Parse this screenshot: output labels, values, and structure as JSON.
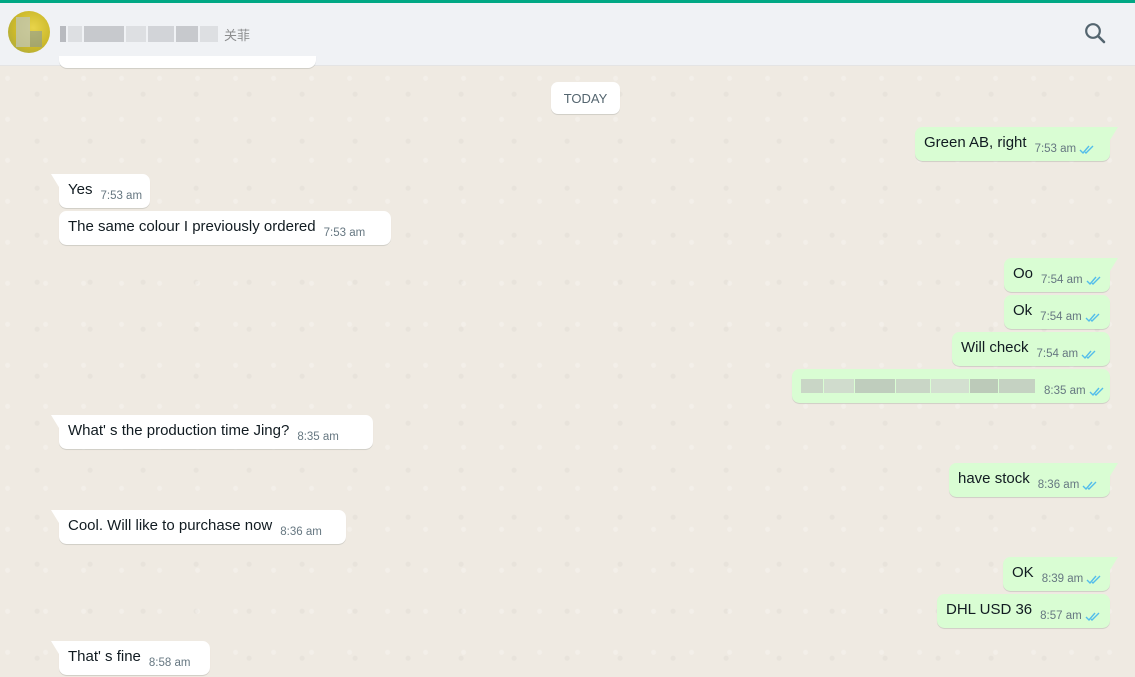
{
  "header": {
    "contact_name_visible": "关菲",
    "search_icon": "search-icon",
    "accent_color": "#00a884"
  },
  "chat": {
    "day_label": "TODAY",
    "messages": [
      {
        "dir": "out",
        "text": "Green AB, right",
        "time": "7:53 am",
        "status": "read"
      },
      {
        "dir": "in",
        "text": "Yes",
        "time": "7:53 am"
      },
      {
        "dir": "in",
        "text": "The same colour I previously ordered",
        "time": "7:53 am"
      },
      {
        "dir": "out",
        "text": "Oo",
        "time": "7:54 am",
        "status": "read"
      },
      {
        "dir": "out",
        "text": "Ok",
        "time": "7:54 am",
        "status": "read"
      },
      {
        "dir": "out",
        "text": "Will check",
        "time": "7:54 am",
        "status": "read"
      },
      {
        "dir": "out",
        "text": "",
        "redacted": true,
        "time": "8:35 am",
        "status": "read"
      },
      {
        "dir": "in",
        "text": "What' s the production time Jing?",
        "time": "8:35 am"
      },
      {
        "dir": "out",
        "text": "have stock",
        "time": "8:36 am",
        "status": "read"
      },
      {
        "dir": "in",
        "text": "Cool. Will like to purchase now",
        "time": "8:36 am"
      },
      {
        "dir": "out",
        "text": "OK",
        "time": "8:39 am",
        "status": "read"
      },
      {
        "dir": "out",
        "text": "DHL USD 36",
        "time": "8:57 am",
        "status": "read"
      },
      {
        "dir": "in",
        "text": "That' s fine",
        "time": "8:58 am"
      }
    ]
  },
  "colors": {
    "incoming_bubble": "#ffffff",
    "outgoing_bubble": "#d9fdd3",
    "read_tick": "#53bdeb",
    "chat_background": "#efeae2"
  }
}
